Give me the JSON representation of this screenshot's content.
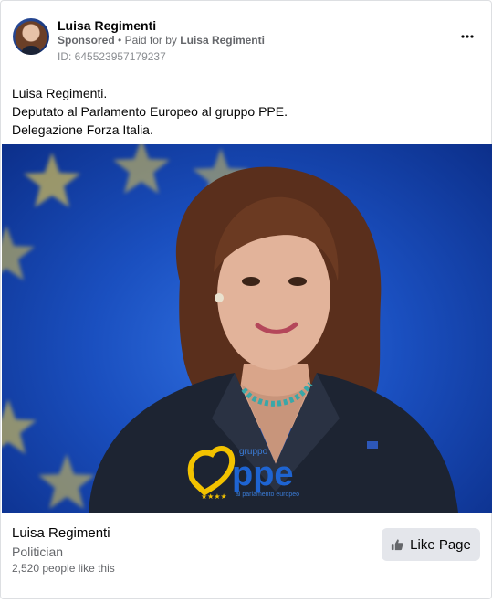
{
  "post": {
    "page_name": "Luisa Regimenti",
    "sponsored": "Sponsored",
    "separator": "•",
    "paid_for_prefix": "Paid for by",
    "paid_for_name": "Luisa Regimenti",
    "ad_id": "ID: 645523957179237",
    "more_icon": "more-options-icon",
    "body_lines": [
      "Luisa Regimenti.",
      "Deputato al Parlamento Europeo al gruppo PPE.",
      "Delegazione Forza Italia."
    ]
  },
  "image": {
    "logo": {
      "small_word": "gruppo",
      "big_word": "ppe",
      "tagline": "al parlamento europeo"
    },
    "colors": {
      "background": "#1a4fbf",
      "star": "#f6d54a",
      "logo_blue": "#1e64d2",
      "logo_yellow": "#f2c200"
    }
  },
  "footer": {
    "name": "Luisa Regimenti",
    "category": "Politician",
    "likes": "2,520 people like this",
    "like_button_label": "Like Page",
    "like_icon": "thumbs-up-icon"
  }
}
